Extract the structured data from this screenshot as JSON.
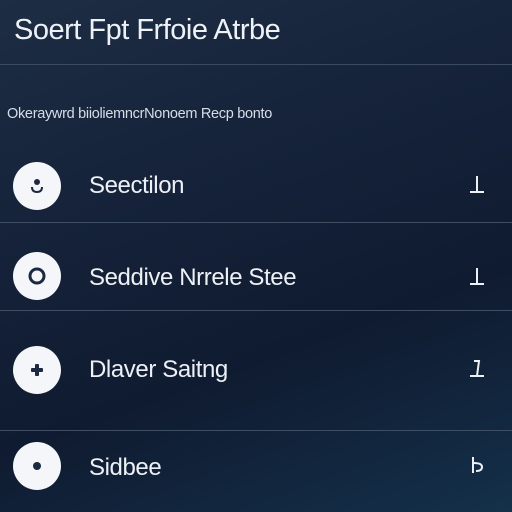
{
  "header": {
    "title": "Soert Fpt Frfoie Atrbe"
  },
  "subtitle": "Okeraywrd biioliemncrNonoem Recp bonto",
  "rows": [
    {
      "label": "Seectilon",
      "icon": "head-icon",
      "end_icon": "pin-icon"
    },
    {
      "label": "Seddive Nrrele Stee",
      "icon": "ring-icon",
      "end_icon": "pin-icon"
    },
    {
      "label": "Dlaver Saitng",
      "icon": "plus-icon",
      "end_icon": "pin-icon"
    },
    {
      "label": "Sidbee",
      "icon": "dot-icon",
      "end_icon": "hook-icon"
    }
  ],
  "colors": {
    "background": "#142138",
    "divider": "#3f4f63",
    "icon_circle": "#f4f6f9",
    "icon_glyph": "#1b2a40",
    "text": "#edf1f6"
  }
}
